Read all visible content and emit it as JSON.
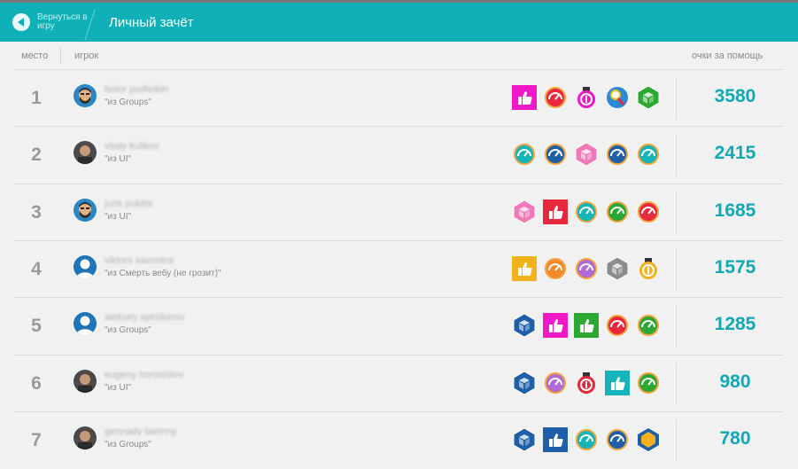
{
  "header": {
    "back_label": "Вернуться в игру",
    "title": "Личный зачёт"
  },
  "columns": {
    "place": "место",
    "player": "игрок",
    "points": "очки за помощь"
  },
  "rows": [
    {
      "rank": "1",
      "name": "fedor podtelkin",
      "team": "\"из Groups\"",
      "avatar": "avatar-beard",
      "points": "3580",
      "badges": [
        "thumbs-up-magenta-badge",
        "gauge-red-badge",
        "medal-magenta-badge",
        "magnifier-badge",
        "cube-green-badge"
      ]
    },
    {
      "rank": "2",
      "name": "vitaly kulikov",
      "team": "\"из UI\"",
      "avatar": "avatar-photo",
      "points": "2415",
      "badges": [
        "gauge-teal-badge",
        "gauge-blue-badge",
        "cube-pink-badge",
        "gauge-blue-badge",
        "gauge-teal-badge"
      ]
    },
    {
      "rank": "3",
      "name": "juris pukitis",
      "team": "\"из UI\"",
      "avatar": "avatar-beard",
      "points": "1685",
      "badges": [
        "cube-pink-badge",
        "thumbs-up-red-badge",
        "gauge-teal-badge",
        "gauge-green-badge",
        "gauge-red-badge"
      ]
    },
    {
      "rank": "4",
      "name": "viktors savonins",
      "team": "\"из Смерть вебу (не грозит)\"",
      "avatar": "avatar-default",
      "points": "1575",
      "badges": [
        "thumbs-up-yellow-badge",
        "gauge-orange-badge",
        "gauge-purple-badge",
        "cube-gray-badge",
        "medal-yellow-badge"
      ]
    },
    {
      "rank": "5",
      "name": "aleksey spiridonov",
      "team": "\"из Groups\"",
      "avatar": "avatar-default",
      "points": "1285",
      "badges": [
        "cube-blue-badge",
        "thumbs-up-magenta-badge",
        "thumbs-up-green-badge",
        "gauge-red-badge",
        "gauge-green-badge"
      ]
    },
    {
      "rank": "6",
      "name": "eugeny horoshilov",
      "team": "\"из UI\"",
      "avatar": "avatar-photo",
      "points": "980",
      "badges": [
        "cube-blue-badge",
        "gauge-purple-badge",
        "medal-red-badge",
        "thumbs-up-teal-badge",
        "gauge-green-badge"
      ]
    },
    {
      "rank": "7",
      "name": "gennady barinny",
      "team": "\"из Groups\"",
      "avatar": "avatar-photo",
      "points": "780",
      "badges": [
        "cube-blue-badge",
        "thumbs-up-blue-badge",
        "gauge-teal-badge",
        "gauge-blue-badge",
        "hexagon-yellow-badge"
      ]
    }
  ],
  "colors": {
    "header": "#0fb0b8",
    "points": "#10a9b5"
  }
}
